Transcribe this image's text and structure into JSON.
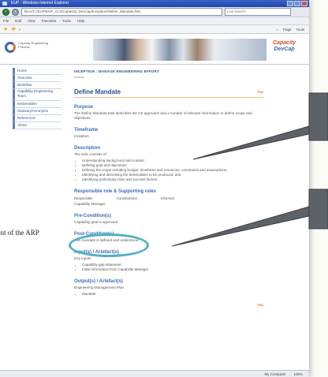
{
  "browser": {
    "title": "EUP - Windows Internet Explorer",
    "address": "file:///C:/EUP/EUP_v1.0/Capacity_DevCap/Inception/Define_Mandate.htm",
    "search_placeholder": "Live Search",
    "menu": [
      "File",
      "Edit",
      "View",
      "Favorites",
      "Tools",
      "Help"
    ],
    "toolbar_right": [
      "Page",
      "Tools"
    ],
    "status_zone": "My Computer",
    "zoom": "100%"
  },
  "banner": {
    "logo_text": "Capacity Engineering Process",
    "brand_line1": "Capacity",
    "brand_line2": "DevCap"
  },
  "sidebar": {
    "items": [
      {
        "label": "Home"
      },
      {
        "label": "Overview"
      },
      {
        "label": "Workflow"
      },
      {
        "label": "Capability Engineering Team"
      },
      {
        "label": "Deliverables"
      },
      {
        "label": "Glossary/Acronyms"
      },
      {
        "label": "References"
      },
      {
        "label": "About"
      }
    ]
  },
  "content": {
    "breadcrumb": "INCEPTION : MANAGE ENGINEERING EFFORT",
    "breadcrumb_sub": "Activity",
    "title": "Define Mandate",
    "top_link": "Top",
    "purpose_heading": "Purpose",
    "purpose_text": "The Define Mandate task describes the CE approach and a number of relevant information to define scope and objectives.",
    "timeframe_heading": "Timeframe",
    "timeframe_text": "Inception",
    "description_heading": "Description",
    "description_intro": "The task consists of:",
    "description_items": [
      "Understanding background and context;",
      "Defining goal and objectives;",
      "Defining the scope including budget, timeframe and resources, constraints and assumptions;",
      "Identifying and describing the deliverables to be produced; and",
      "Identifying preliminary risks and success factors."
    ],
    "roles_heading": "Responsible role & Supporting roles",
    "roles_col1": "Responsible",
    "roles_col2": "Contributor(s)",
    "roles_col3": "Informed",
    "roles_value": "Capability Manager",
    "preconditions_heading": "Pre-Condition(s)",
    "preconditions_text": "Capability goal is approved",
    "postconditions_heading": "Post-Condition(s)",
    "postconditions_text": "The mandate is defined and understood",
    "inputs_heading": "Input(s) / Artefact(s)",
    "inputs_intro": "Key inputs:",
    "inputs_items": [
      "Capability gap statement",
      "Initial information from Capability Manager"
    ],
    "outputs_heading": "Output(s) / Artefact(s)",
    "outputs_intro": "Engineering Management Plan",
    "outputs_items": [
      "Mandate"
    ],
    "bottom_link": "Top"
  },
  "outside_caption": "ont of the ARP"
}
